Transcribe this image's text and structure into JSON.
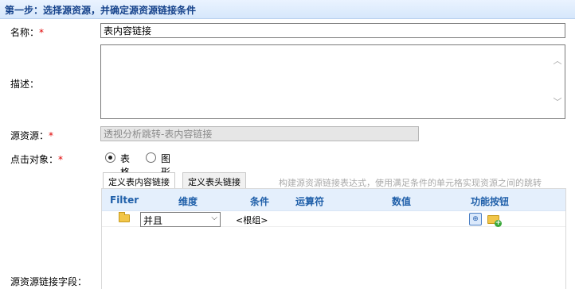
{
  "step": {
    "title": "第一步：选择源资源，并确定源资源链接条件"
  },
  "form": {
    "name_label": "名称：",
    "name_value": "表内容链接",
    "desc_label": "描述：",
    "source_label": "源资源：",
    "source_value": "透视分析跳转-表内容链接",
    "click_target_label": "点击对象：",
    "click_target_options": [
      "表格",
      "图形"
    ],
    "click_target_selected": "表格",
    "link_field_label": "源资源链接字段：",
    "required_mark": "*"
  },
  "tabs": [
    {
      "label": "定义表内容链接",
      "active": true
    },
    {
      "label": "定义表头链接",
      "active": false
    }
  ],
  "tab_hint": "构建源资源链接表达式，使用满足条件的单元格实现资源之间的跳转",
  "grid": {
    "headers": [
      "Filter",
      "维度",
      "条件",
      "运算符",
      "数值",
      "功能按钮"
    ],
    "row": {
      "logic_value": "并且",
      "root_text": "<根组>",
      "icons": [
        "folder-icon",
        "add-condition-icon",
        "add-group-icon"
      ]
    }
  },
  "colors": {
    "header_text": "#15428b",
    "grid_header_text": "#1f5fa9",
    "required": "#e00000"
  }
}
